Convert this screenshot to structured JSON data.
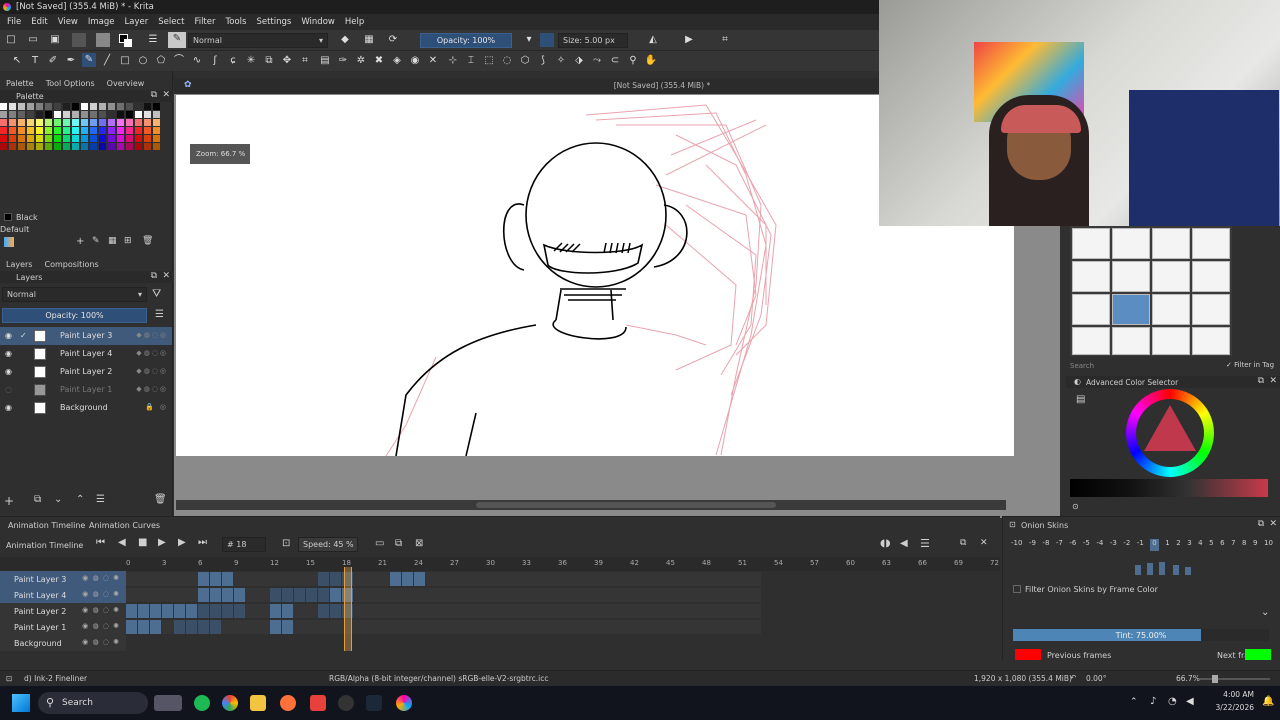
{
  "window": {
    "title": "[Not Saved]  (355.4 MiB) * - Krita"
  },
  "menu": [
    "File",
    "Edit",
    "View",
    "Image",
    "Layer",
    "Select",
    "Filter",
    "Tools",
    "Settings",
    "Window",
    "Help"
  ],
  "toolbar": {
    "blend_mode": "Normal",
    "opacity_label": "Opacity: 100%",
    "size_label": "Size: 5.00 px"
  },
  "left_panel": {
    "tabs": [
      "Palette",
      "Tool Options",
      "Overview"
    ],
    "palette_title": "Palette",
    "current_color_name": "Black",
    "palette_name": "Default",
    "layers_tabs": [
      "Layers",
      "Compositions"
    ],
    "layer_blend": "Normal",
    "layer_opacity": "Opacity:  100%",
    "layers": [
      {
        "name": "Paint Layer 3",
        "selected": true
      },
      {
        "name": "Paint Layer 4",
        "selected": false
      },
      {
        "name": "Paint Layer 2",
        "selected": false
      },
      {
        "name": "Paint Layer 1",
        "selected": false,
        "hidden": true
      },
      {
        "name": "Background",
        "selected": false,
        "locked": true
      }
    ]
  },
  "canvas": {
    "doc_title": "[Not Saved]  (355.4 MiB) *",
    "zoom_tooltip": "Zoom: 66.7 %"
  },
  "right_panel": {
    "brush_search_placeholder": "Search",
    "filter_in_tag": "Filter in Tag",
    "color_selector_title": "Advanced Color Selector"
  },
  "timeline": {
    "tabs": [
      "Animation Timeline",
      "Animation Curves"
    ],
    "title": "Animation Timeline",
    "current_frame": "18",
    "speed": "Speed: 45 %",
    "ticks": [
      "0",
      "3",
      "6",
      "9",
      "12",
      "15",
      "18",
      "21",
      "24",
      "27",
      "30",
      "33",
      "36",
      "39",
      "42",
      "45",
      "48",
      "51",
      "54",
      "57",
      "60",
      "63",
      "66",
      "69",
      "72"
    ],
    "rows": [
      {
        "name": "Paint Layer 3",
        "selected": true
      },
      {
        "name": "Paint Layer 4",
        "selected": true
      },
      {
        "name": "Paint Layer 2",
        "selected": false
      },
      {
        "name": "Paint Layer 1",
        "selected": false
      },
      {
        "name": "Background",
        "selected": false
      }
    ]
  },
  "onion": {
    "title": "Onion Skins",
    "numbers": [
      "-10",
      "-9",
      "-8",
      "-7",
      "-6",
      "-5",
      "-4",
      "-3",
      "-2",
      "-1",
      "0",
      "1",
      "2",
      "3",
      "4",
      "5",
      "6",
      "7",
      "8",
      "9",
      "10"
    ],
    "filter_label": "Filter Onion Skins by Frame Color",
    "tint": "Tint: 75.00%",
    "previous_frames": "Previous frames",
    "next_frames": "Next frames",
    "prev_color": "#ff0000",
    "next_color": "#00ff00"
  },
  "status": {
    "brush": "d) Ink-2 Fineliner",
    "color_space": "RGB/Alpha (8-bit integer/channel)  sRGB-elle-V2-srgbtrc.icc",
    "dimensions": "1,920 x 1,080 (355.4 MiB)",
    "rotation": "0.00°",
    "zoom": "66.7%"
  },
  "taskbar": {
    "search": "Search",
    "time": "4:00 AM",
    "date": "3/22/2026"
  }
}
